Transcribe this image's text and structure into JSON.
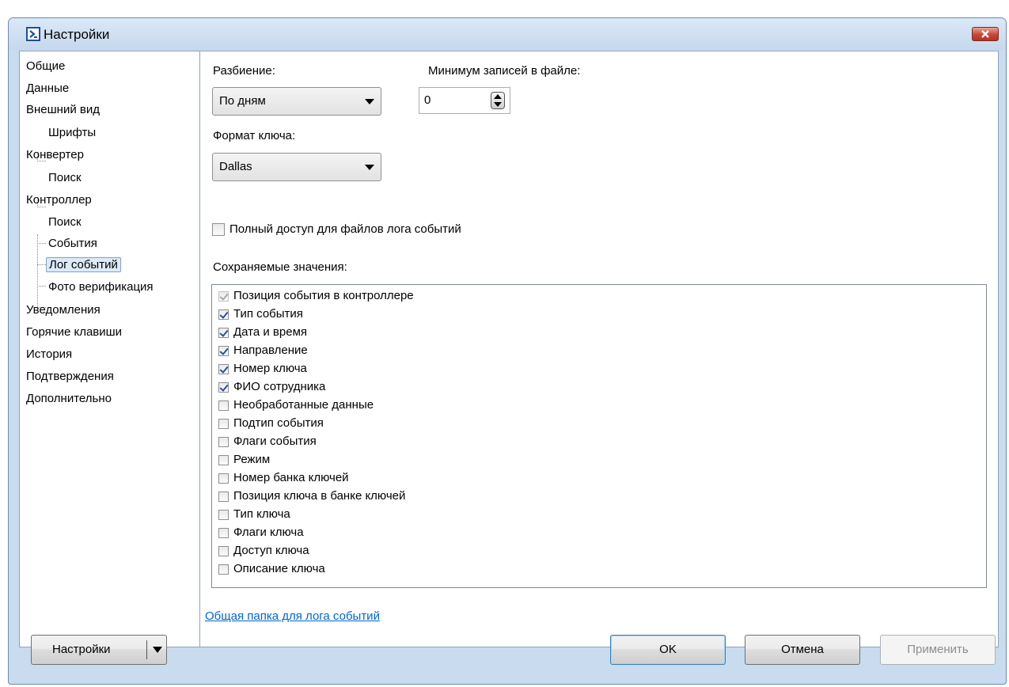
{
  "window": {
    "title": "Настройки"
  },
  "nav": {
    "items": [
      {
        "label": "Общие"
      },
      {
        "label": "Данные"
      },
      {
        "label": "Внешний вид"
      },
      {
        "label": "Шрифты"
      },
      {
        "label": "Конвертер"
      },
      {
        "label": "Поиск"
      },
      {
        "label": "Контроллер"
      },
      {
        "label": "Поиск"
      },
      {
        "label": "События"
      },
      {
        "label": "Лог событий"
      },
      {
        "label": "Фото верификация"
      },
      {
        "label": "Уведомления"
      },
      {
        "label": "Горячие клавиши"
      },
      {
        "label": "История"
      },
      {
        "label": "Подтверждения"
      },
      {
        "label": "Дополнительно"
      }
    ],
    "selected": "Лог событий"
  },
  "panel": {
    "split_label": "Разбиение:",
    "split_value": "По дням",
    "min_records_label": "Минимум записей в файле:",
    "min_records_value": "0",
    "key_format_label": "Формат ключа:",
    "key_format_value": "Dallas",
    "full_access_label": "Полный доступ для файлов лога событий",
    "full_access_checked": false,
    "saved_values_label": "Сохраняемые значения:",
    "saved_values": [
      {
        "label": "Позиция события в контроллере",
        "checked": true,
        "disabled": true
      },
      {
        "label": "Тип события",
        "checked": true
      },
      {
        "label": "Дата и время",
        "checked": true
      },
      {
        "label": "Направление",
        "checked": true
      },
      {
        "label": "Номер ключа",
        "checked": true
      },
      {
        "label": "ФИО сотрудника",
        "checked": true
      },
      {
        "label": "Необработанные данные",
        "checked": false
      },
      {
        "label": "Подтип события",
        "checked": false
      },
      {
        "label": "Флаги события",
        "checked": false
      },
      {
        "label": "Режим",
        "checked": false
      },
      {
        "label": "Номер банка ключей",
        "checked": false
      },
      {
        "label": "Позиция ключа в банке ключей",
        "checked": false
      },
      {
        "label": "Тип ключа",
        "checked": false
      },
      {
        "label": "Флаги ключа",
        "checked": false
      },
      {
        "label": "Доступ ключа",
        "checked": false
      },
      {
        "label": "Описание ключа",
        "checked": false
      }
    ],
    "shared_folder_link": "Общая папка для лога событий"
  },
  "footer": {
    "settings_button": "Настройки",
    "ok_button": "OK",
    "cancel_button": "Отмена",
    "apply_button": "Применить"
  },
  "colors": {
    "window_frame": "#c9dbee",
    "link": "#0066cc",
    "close_button": "#c7463a"
  }
}
